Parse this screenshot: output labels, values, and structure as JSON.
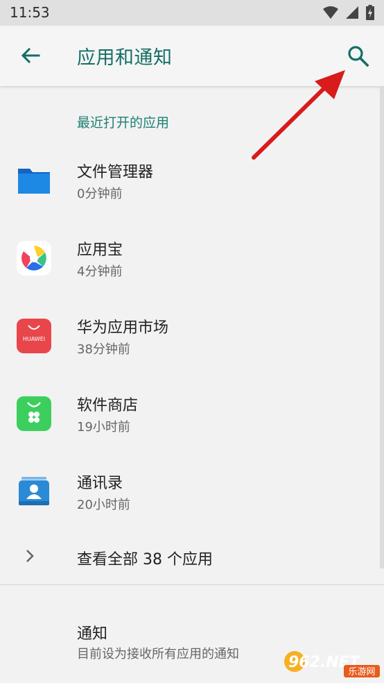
{
  "status_bar": {
    "time": "11:53"
  },
  "app_bar": {
    "title": "应用和通知"
  },
  "recent_section": {
    "header": "最近打开的应用",
    "apps": [
      {
        "name": "文件管理器",
        "time": "0分钟前",
        "icon": "folder-icon",
        "color": "#1e88e5"
      },
      {
        "name": "应用宝",
        "time": "4分钟前",
        "icon": "yingyongbao-icon",
        "color": "#ffffff"
      },
      {
        "name": "华为应用市场",
        "time": "38分钟前",
        "icon": "huawei-appgallery-icon",
        "color": "#e8464b"
      },
      {
        "name": "软件商店",
        "time": "19小时前",
        "icon": "software-store-icon",
        "color": "#3ccf5e"
      },
      {
        "name": "通讯录",
        "time": "20小时前",
        "icon": "contacts-icon",
        "color": "#2a8ad6"
      }
    ],
    "see_all": "查看全部 38 个应用"
  },
  "notifications": {
    "title": "通知",
    "summary": "目前设为接收所有应用的通知"
  },
  "watermark": {
    "text_main": "962.NET",
    "text_sub": "乐游网"
  },
  "colors": {
    "accent": "#136e65",
    "annotation_arrow": "#d81b1b"
  }
}
